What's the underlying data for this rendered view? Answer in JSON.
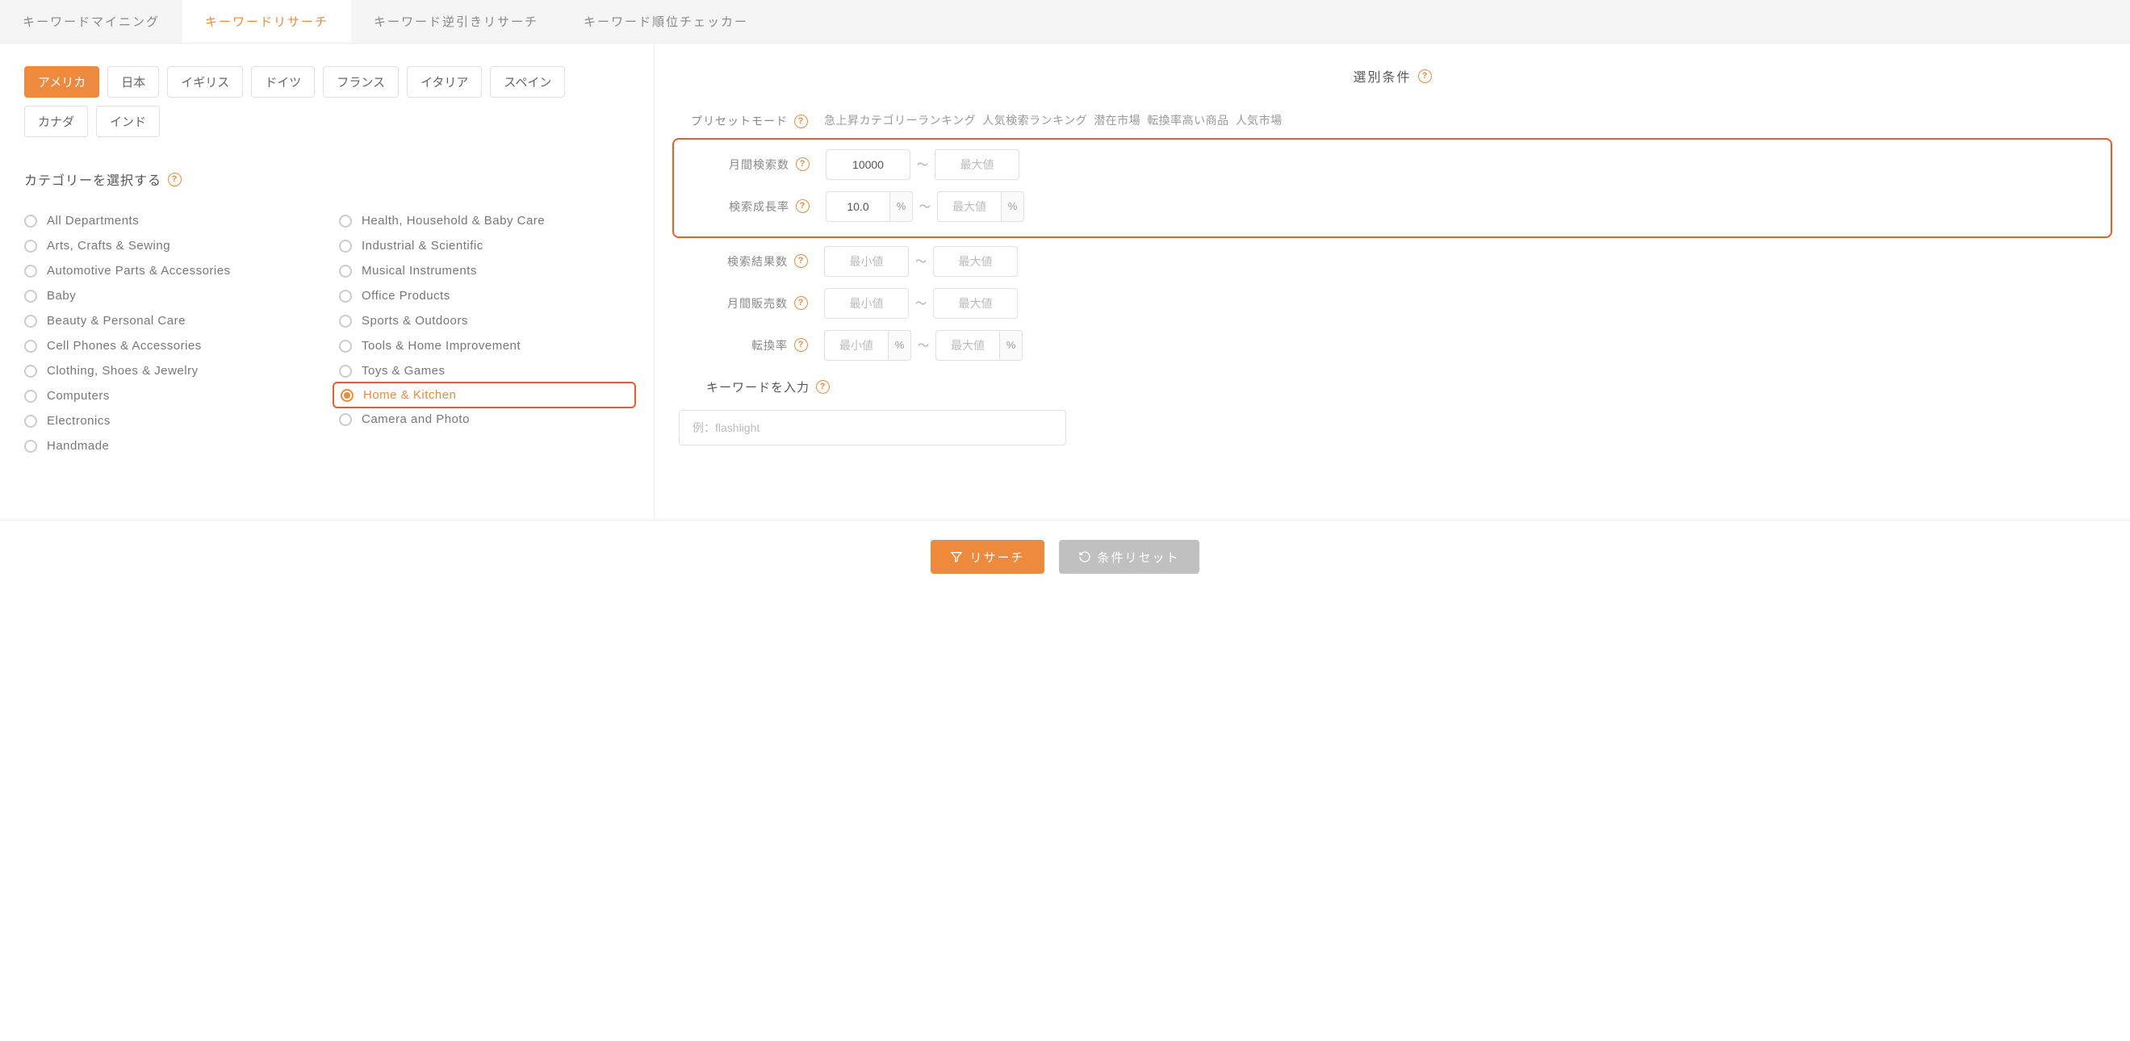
{
  "tabs": [
    {
      "label": "キーワードマイニング",
      "active": false
    },
    {
      "label": "キーワードリサーチ",
      "active": true
    },
    {
      "label": "キーワード逆引きリサーチ",
      "active": false
    },
    {
      "label": "キーワード順位チェッカー",
      "active": false
    }
  ],
  "countries": [
    {
      "label": "アメリカ",
      "active": true
    },
    {
      "label": "日本",
      "active": false
    },
    {
      "label": "イギリス",
      "active": false
    },
    {
      "label": "ドイツ",
      "active": false
    },
    {
      "label": "フランス",
      "active": false
    },
    {
      "label": "イタリア",
      "active": false
    },
    {
      "label": "スペイン",
      "active": false
    },
    {
      "label": "カナダ",
      "active": false
    },
    {
      "label": "インド",
      "active": false
    }
  ],
  "category_title": "カテゴリーを選択する",
  "categories_left": [
    "All Departments",
    "Arts, Crafts & Sewing",
    "Automotive Parts & Accessories",
    "Baby",
    "Beauty & Personal Care",
    "Cell Phones & Accessories",
    "Clothing, Shoes & Jewelry",
    "Computers",
    "Electronics",
    "Handmade"
  ],
  "categories_right": [
    {
      "label": "Health, Household & Baby Care",
      "selected": false
    },
    {
      "label": "Industrial & Scientific",
      "selected": false
    },
    {
      "label": "Musical Instruments",
      "selected": false
    },
    {
      "label": "Office Products",
      "selected": false
    },
    {
      "label": "Sports & Outdoors",
      "selected": false
    },
    {
      "label": "Tools & Home Improvement",
      "selected": false
    },
    {
      "label": "Toys & Games",
      "selected": false
    },
    {
      "label": "Home & Kitchen",
      "selected": true
    },
    {
      "label": "Camera and Photo",
      "selected": false
    }
  ],
  "right": {
    "title": "選別条件",
    "preset_label": "プリセットモード",
    "preset_links": [
      "急上昇カテゴリーランキング",
      "人気検索ランキング",
      "潜在市場",
      "転換率高い商品",
      "人気市場"
    ],
    "filters": [
      {
        "label": "月間検索数",
        "min": "10000",
        "max": "",
        "min_ph": "最小値",
        "max_ph": "最大値",
        "suffix": "",
        "highlight": true
      },
      {
        "label": "検索成長率",
        "min": "10.0",
        "max": "",
        "min_ph": "最小値",
        "max_ph": "最大値",
        "suffix": "%",
        "highlight": true
      },
      {
        "label": "検索結果数",
        "min": "",
        "max": "",
        "min_ph": "最小値",
        "max_ph": "最大値",
        "suffix": "",
        "highlight": false
      },
      {
        "label": "月間販売数",
        "min": "",
        "max": "",
        "min_ph": "最小値",
        "max_ph": "最大値",
        "suffix": "",
        "highlight": false
      },
      {
        "label": "転換率",
        "min": "",
        "max": "",
        "min_ph": "最小値",
        "max_ph": "最大値",
        "suffix": "%",
        "highlight": false
      }
    ],
    "keyword_title": "キーワードを入力",
    "keyword_placeholder": "例：flashlight",
    "keyword_value": ""
  },
  "footer": {
    "research_label": "リサーチ",
    "reset_label": "条件リセット"
  }
}
